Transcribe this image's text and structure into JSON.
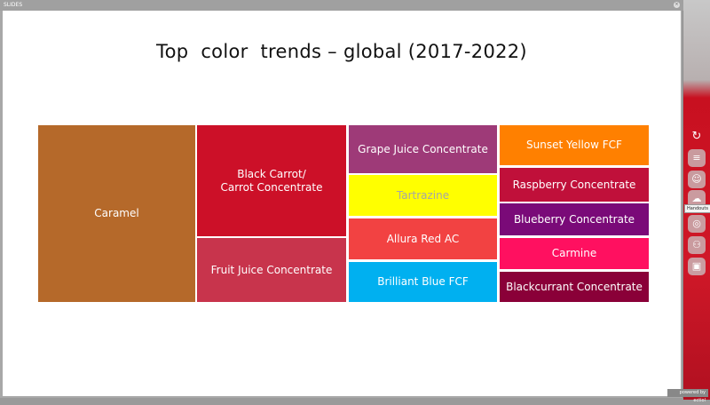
{
  "window": {
    "title": "SLIDES",
    "close_icon": "close-icon"
  },
  "slide": {
    "title": "Top  color  trends – global (2017-2022)",
    "tiles": [
      {
        "label": "Caramel",
        "color": "#b5692a",
        "text_color": "#ffffff"
      },
      {
        "label": "Black Carrot/\nCarrot Concentrate",
        "color": "#cc1028",
        "text_color": "#ffffff"
      },
      {
        "label": "Fruit Juice Concentrate",
        "color": "#c8344c",
        "text_color": "#ffffff"
      },
      {
        "label": "Grape Juice Concentrate",
        "color": "#9e3a78",
        "text_color": "#ffffff"
      },
      {
        "label": "Tartrazine",
        "color": "#ffff00",
        "text_color": "#a6a6a6"
      },
      {
        "label": "Allura Red AC",
        "color": "#f24242",
        "text_color": "#ffffff"
      },
      {
        "label": "Brilliant Blue FCF",
        "color": "#00b0f0",
        "text_color": "#ffffff"
      },
      {
        "label": "Sunset Yellow FCF",
        "color": "#ff8000",
        "text_color": "#ffffff"
      },
      {
        "label": "Raspberry Concentrate",
        "color": "#c0103a",
        "text_color": "#ffffff"
      },
      {
        "label": "Blueberry Concentrate",
        "color": "#7a0a78",
        "text_color": "#ffffff"
      },
      {
        "label": "Carmine",
        "color": "#ff1060",
        "text_color": "#ffffff"
      },
      {
        "label": "Blackcurrant Concentrate",
        "color": "#8a0038",
        "text_color": "#ffffff"
      }
    ]
  },
  "rail": {
    "icons": [
      "refresh-icon",
      "menu-icon",
      "user-check-icon",
      "handouts-cloud-icon",
      "compass-icon",
      "group-icon",
      "chat-icon"
    ],
    "tooltip": "Handouts"
  },
  "badge": "powered by ectiol"
}
